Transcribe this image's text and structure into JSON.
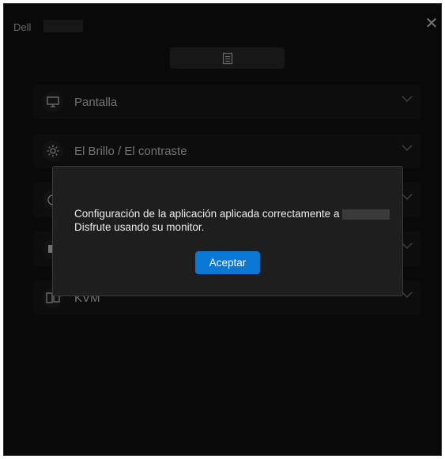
{
  "window": {
    "brand": "Dell",
    "close_glyph": "✕"
  },
  "sections": [
    {
      "label": "Pantalla",
      "icon": "monitor-icon"
    },
    {
      "label": "El Brillo / El contraste",
      "icon": "brightness-icon"
    },
    {
      "label": "",
      "icon": "input-source-icon"
    },
    {
      "label": "",
      "icon": "color-icon"
    },
    {
      "label": "KVM",
      "icon": "kvm-icon"
    }
  ],
  "dialog": {
    "message_line1": "Configuración de la aplicación aplicada correctamente a",
    "message_line2": "Disfrute usando su monitor.",
    "accept_label": "Aceptar"
  },
  "colors": {
    "background": "#111111",
    "accent": "#0a78d4"
  }
}
